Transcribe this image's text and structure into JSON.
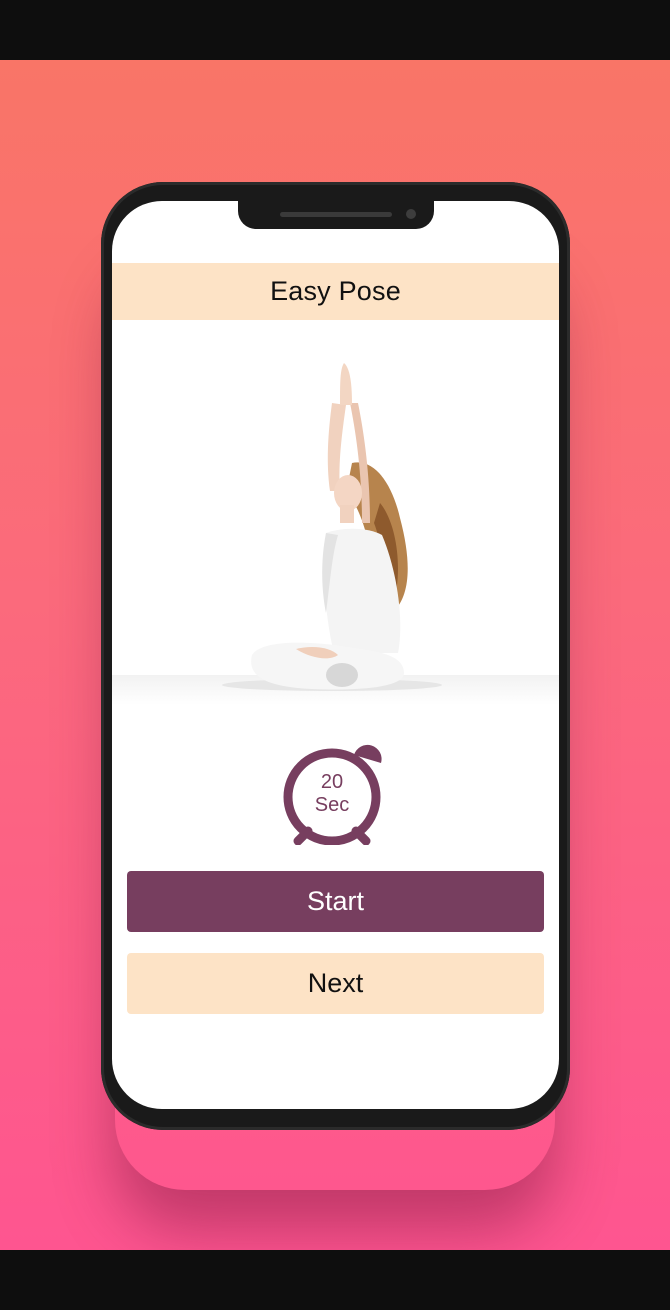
{
  "screen": {
    "title": "Easy Pose",
    "image_icon": "yoga-pose-illustration",
    "timer": {
      "icon": "alarm-clock-icon",
      "value": "20",
      "unit": "Sec"
    },
    "buttons": {
      "start_label": "Start",
      "next_label": "Next"
    }
  },
  "colors": {
    "accent": "#773e5f",
    "header_bg": "#fde3c6",
    "background_gradient_top": "#f97567",
    "background_gradient_bottom": "#fe5590"
  }
}
